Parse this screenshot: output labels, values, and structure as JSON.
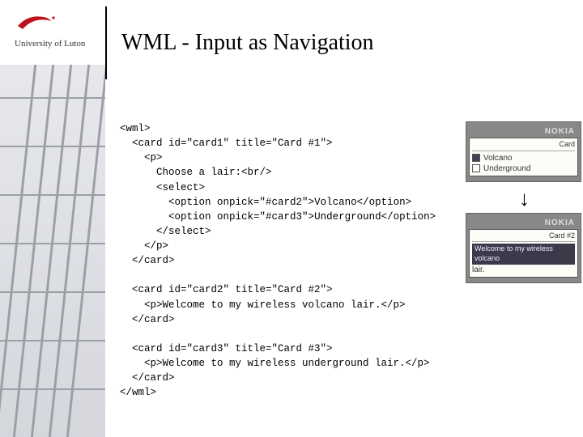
{
  "header": {
    "institution": "University of Luton",
    "title": "WML - Input as Navigation"
  },
  "code_lines": [
    "<wml>",
    "  <card id=\"card1\" title=\"Card #1\">",
    "    <p>",
    "      Choose a lair:<br/>",
    "      <select>",
    "        <option onpick=\"#card2\">Volcano</option>",
    "        <option onpick=\"#card3\">Underground</option>",
    "      </select>",
    "    </p>",
    "  </card>",
    "",
    "  <card id=\"card2\" title=\"Card #2\">",
    "    <p>Welcome to my wireless volcano lair.</p>",
    "  </card>",
    "",
    "  <card id=\"card3\" title=\"Card #3\">",
    "    <p>Welcome to my wireless underground lair.</p>",
    "  </card>",
    "</wml>"
  ],
  "phones": {
    "brand": "NOKIA",
    "card1": {
      "header": "Card",
      "options": [
        {
          "label": "Volcano",
          "selected": true
        },
        {
          "label": "Underground",
          "selected": false
        }
      ]
    },
    "arrow": "↓",
    "card2": {
      "header": "Card #2",
      "title_bar": "Welcome to my wireless volcano",
      "body": "lair."
    }
  }
}
